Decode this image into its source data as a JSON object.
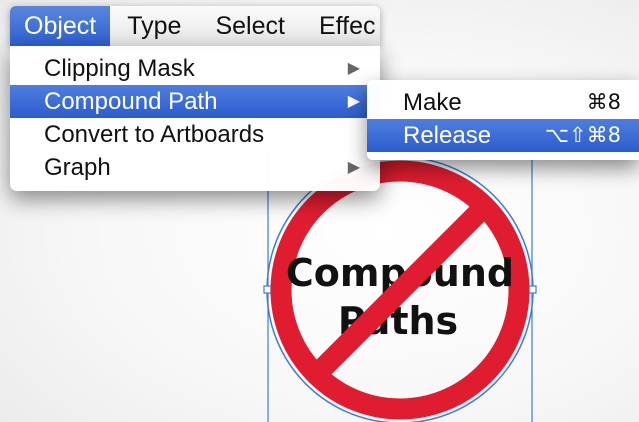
{
  "menubar": {
    "items": [
      {
        "label": "Object",
        "active": true
      },
      {
        "label": "Type"
      },
      {
        "label": "Select"
      },
      {
        "label": "Effec"
      }
    ]
  },
  "object_menu": {
    "items": [
      {
        "label": "Clipping Mask",
        "submenu_icon": "triangle-right-icon"
      },
      {
        "label": "Compound Path",
        "submenu_icon": "triangle-right-icon",
        "highlighted": true
      },
      {
        "label": "Convert to Artboards"
      },
      {
        "label": "Graph",
        "submenu_icon": "triangle-right-icon"
      }
    ]
  },
  "compound_path_submenu": {
    "items": [
      {
        "label": "Make",
        "shortcut": "⌘8"
      },
      {
        "label": "Release",
        "shortcut": "⌥⇧⌘8",
        "highlighted": true
      }
    ]
  },
  "artwork": {
    "line1": "Compound",
    "line2": "Paths",
    "colors": {
      "prohibition_red": "#e01d30",
      "selection_blue": "#3b7fd6",
      "text": "#111111"
    }
  },
  "colors": {
    "menu_highlight": "#2c5dcc",
    "menubar_bg": "#ececec"
  }
}
